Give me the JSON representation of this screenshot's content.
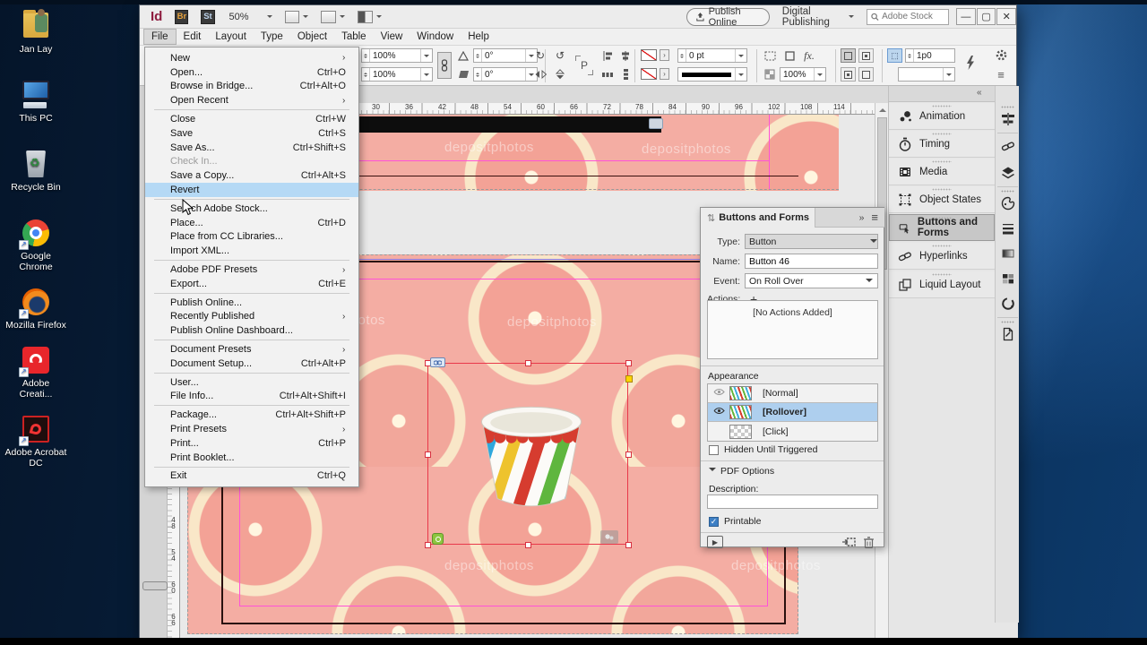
{
  "desktop": {
    "icons": [
      {
        "label": "Jan Lay"
      },
      {
        "label": "This PC"
      },
      {
        "label": "Recycle Bin"
      },
      {
        "label": "Google Chrome"
      },
      {
        "label": "Mozilla Firefox"
      },
      {
        "label": "Adobe Creati..."
      },
      {
        "label": "Adobe Acrobat DC"
      }
    ]
  },
  "titlebar": {
    "app_badge": "Id",
    "bridge_badge": "Br",
    "stock_badge": "St",
    "zoom_level": "50%",
    "publish_button": "Publish Online",
    "workspace": "Digital Publishing",
    "search_placeholder": "Adobe Stock",
    "minimize_glyph": "—",
    "maximize_glyph": "▢",
    "close_glyph": "✕"
  },
  "menubar": {
    "items": [
      "File",
      "Edit",
      "Layout",
      "Type",
      "Object",
      "Table",
      "View",
      "Window",
      "Help"
    ]
  },
  "file_menu": {
    "items": [
      {
        "label": "New",
        "submenu": true
      },
      {
        "label": "Open...",
        "shortcut": "Ctrl+O"
      },
      {
        "label": "Browse in Bridge...",
        "shortcut": "Ctrl+Alt+O"
      },
      {
        "label": "Open Recent",
        "submenu": true
      },
      {
        "sep": true
      },
      {
        "label": "Close",
        "shortcut": "Ctrl+W"
      },
      {
        "label": "Save",
        "shortcut": "Ctrl+S"
      },
      {
        "label": "Save As...",
        "shortcut": "Ctrl+Shift+S"
      },
      {
        "label": "Check In...",
        "disabled": true
      },
      {
        "label": "Save a Copy...",
        "shortcut": "Ctrl+Alt+S"
      },
      {
        "label": "Revert",
        "highlighted": true
      },
      {
        "sep": true
      },
      {
        "label": "Search Adobe Stock..."
      },
      {
        "label": "Place...",
        "shortcut": "Ctrl+D"
      },
      {
        "label": "Place from CC Libraries..."
      },
      {
        "label": "Import XML..."
      },
      {
        "sep": true
      },
      {
        "label": "Adobe PDF Presets",
        "submenu": true
      },
      {
        "label": "Export...",
        "shortcut": "Ctrl+E"
      },
      {
        "sep": true
      },
      {
        "label": "Publish Online..."
      },
      {
        "label": "Recently Published",
        "submenu": true
      },
      {
        "label": "Publish Online Dashboard..."
      },
      {
        "sep": true
      },
      {
        "label": "Document Presets",
        "submenu": true
      },
      {
        "label": "Document Setup...",
        "shortcut": "Ctrl+Alt+P"
      },
      {
        "sep": true
      },
      {
        "label": "User..."
      },
      {
        "label": "File Info...",
        "shortcut": "Ctrl+Alt+Shift+I"
      },
      {
        "sep": true
      },
      {
        "label": "Package...",
        "shortcut": "Ctrl+Alt+Shift+P"
      },
      {
        "label": "Print Presets",
        "submenu": true
      },
      {
        "label": "Print...",
        "shortcut": "Ctrl+P"
      },
      {
        "label": "Print Booklet..."
      },
      {
        "sep": true
      },
      {
        "label": "Exit",
        "shortcut": "Ctrl+Q"
      }
    ]
  },
  "control_panel": {
    "scale_x": "100%",
    "scale_y": "100%",
    "rotation": "0°",
    "shear": "0°",
    "stroke_weight": "0 pt",
    "opacity": "100%",
    "fx_label": "fx.",
    "p_glyph": "P",
    "gap_value": "1p0"
  },
  "rulers": {
    "h": [
      "30",
      "36",
      "42",
      "48",
      "54",
      "60",
      "66",
      "72",
      "78",
      "84",
      "90",
      "96",
      "102",
      "108",
      "114"
    ],
    "v": [
      "48",
      "54",
      "60",
      "66"
    ]
  },
  "canvas": {
    "watermark": "depositphotos"
  },
  "panel": {
    "title": "Buttons and Forms",
    "type_label": "Type:",
    "type_value": "Button",
    "name_label": "Name:",
    "name_value": "Button 46",
    "event_label": "Event:",
    "event_value": "On Roll Over",
    "actions_label": "Actions:",
    "no_actions": "[No Actions Added]",
    "appearance": "Appearance",
    "states": [
      {
        "label": "[Normal]"
      },
      {
        "label": "[Rollover]"
      },
      {
        "label": "[Click]"
      }
    ],
    "hidden_label": "Hidden Until Triggered",
    "pdf_options": "PDF Options",
    "description_label": "Description:",
    "printable_label": "Printable"
  },
  "dock": {
    "panels": [
      "Animation",
      "Timing",
      "Media",
      "Object States",
      "Buttons and Forms",
      "Hyperlinks",
      "Liquid Layout"
    ]
  }
}
